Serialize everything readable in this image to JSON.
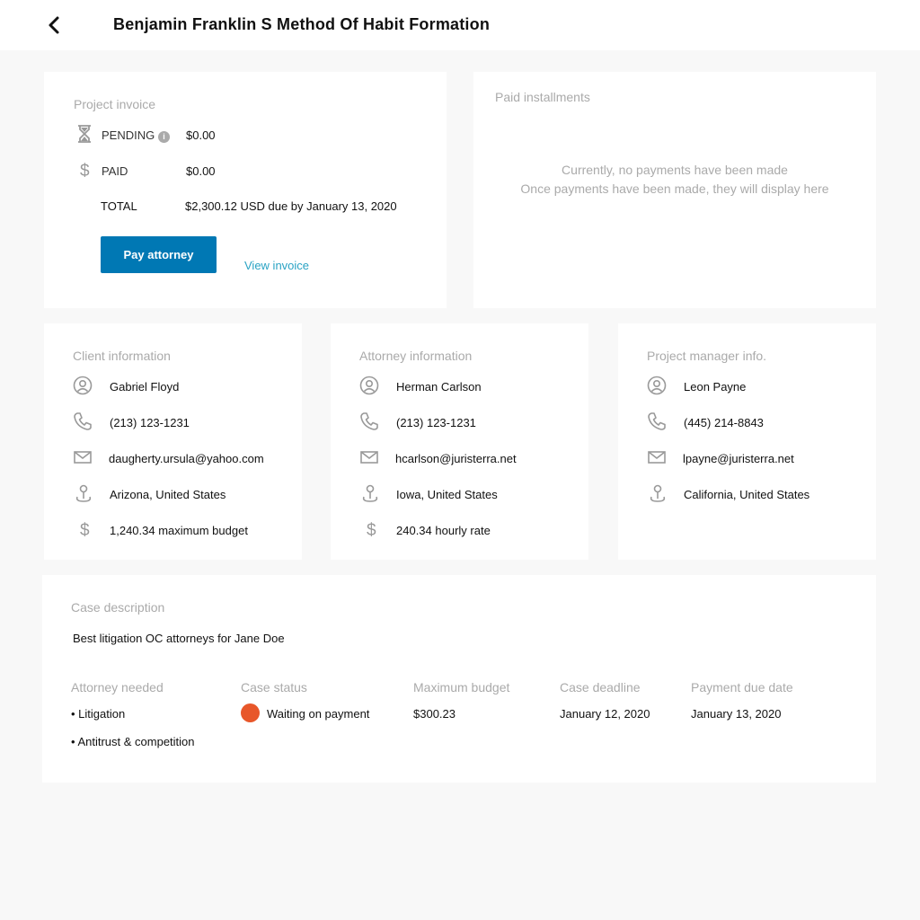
{
  "header": {
    "title": "Benjamin Franklin S Method Of Habit Formation"
  },
  "invoice": {
    "title": "Project invoice",
    "pending_label": "PENDING",
    "pending_value": "$0.00",
    "paid_label": "PAID",
    "paid_value": "$0.00",
    "total_label": "TOTAL",
    "total_value": "$2,300.12 USD due by January 13, 2020",
    "pay_button": "Pay attorney",
    "view_link": "View invoice"
  },
  "installments": {
    "title": "Paid installments",
    "empty_line1": "Currently, no payments have been made",
    "empty_line2": "Once payments have been made, they will display here"
  },
  "client": {
    "title": "Client information",
    "name": "Gabriel Floyd",
    "phone": "(213) 123-1231",
    "email": "daugherty.ursula@yahoo.com",
    "location": "Arizona, United States",
    "budget": "1,240.34 maximum budget"
  },
  "attorney": {
    "title": "Attorney information",
    "name": "Herman Carlson",
    "phone": "(213) 123-1231",
    "email": "hcarlson@juristerra.net",
    "location": "Iowa, United States",
    "rate": "240.34 hourly rate"
  },
  "manager": {
    "title": "Project manager info.",
    "name": "Leon Payne",
    "phone": "(445) 214-8843",
    "email": "lpayne@juristerra.net",
    "location": "California, United States"
  },
  "case": {
    "title": "Case description",
    "description": "Best litigation OC attorneys for Jane Doe",
    "attorney_needed_label": "Attorney needed",
    "attorney_needed": [
      "Litigation",
      "Antitrust & competition"
    ],
    "status_label": "Case status",
    "status": "Waiting on payment",
    "status_color": "#e8572a",
    "budget_label": "Maximum budget",
    "budget": "$300.23",
    "deadline_label": "Case deadline",
    "deadline": "January 12, 2020",
    "due_label": "Payment due date",
    "due": "January 13, 2020"
  },
  "colors": {
    "accent": "#0078b4",
    "link": "#2aa3c4",
    "status": "#e8572a"
  },
  "icons": [
    "back-arrow-icon",
    "hourglass-icon",
    "info-icon",
    "dollar-icon",
    "user-icon",
    "phone-icon",
    "mail-icon",
    "location-icon"
  ]
}
